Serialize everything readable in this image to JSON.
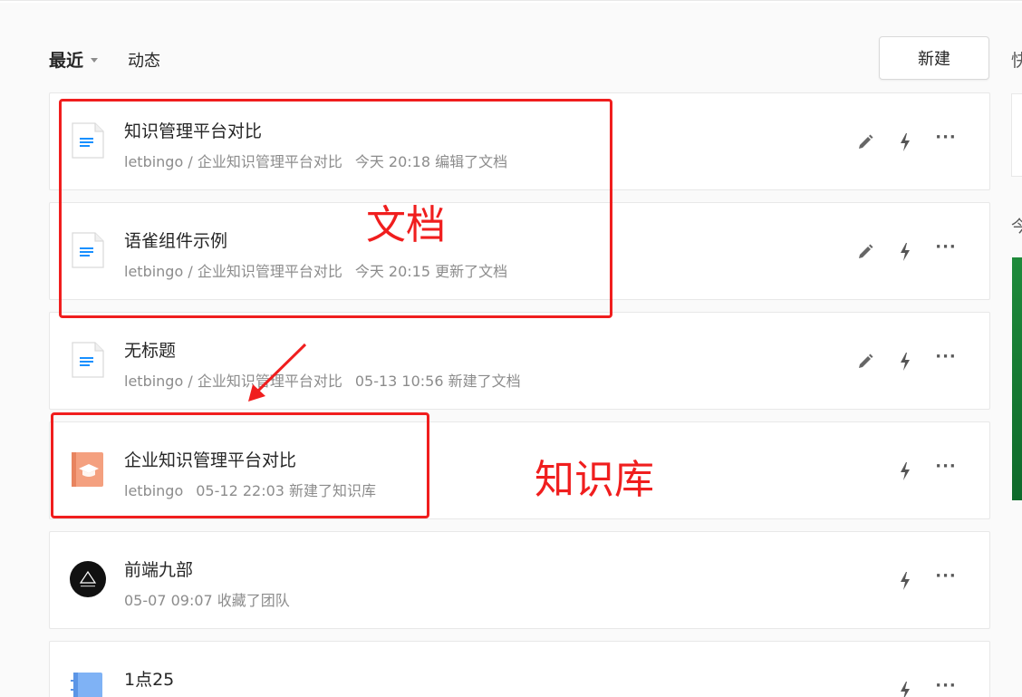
{
  "header": {
    "tab_recent": "最近",
    "tab_activity": "动态",
    "new_button": "新建",
    "right_partial_heading": "快",
    "right_partial_label": "今"
  },
  "items": [
    {
      "type": "doc",
      "title": "知识管理平台对比",
      "path": "letbingo / 企业知识管理平台对比",
      "time": "今天 20:18",
      "action": "编辑了文档",
      "icon": "document-icon",
      "editable": true
    },
    {
      "type": "doc",
      "title": "语雀组件示例",
      "path": "letbingo / 企业知识管理平台对比",
      "time": "今天 20:15",
      "action": "更新了文档",
      "icon": "document-icon",
      "editable": true
    },
    {
      "type": "doc",
      "title": "无标题",
      "path": "letbingo / 企业知识管理平台对比",
      "time": "05-13 10:56",
      "action": "新建了文档",
      "icon": "document-icon",
      "editable": true
    },
    {
      "type": "book",
      "title": "企业知识管理平台对比",
      "path": "letbingo",
      "time": "05-12 22:03",
      "action": "新建了知识库",
      "icon": "knowledge-base-icon",
      "editable": false
    },
    {
      "type": "team",
      "title": "前端九部",
      "path": "",
      "time": "05-07 09:07",
      "action": "收藏了团队",
      "icon": "team-avatar",
      "editable": false
    },
    {
      "type": "notebook",
      "title": "1点25",
      "path": "",
      "time": "",
      "action": "",
      "icon": "notebook-icon",
      "editable": false
    }
  ],
  "annotations": {
    "docs_label": "文档",
    "kb_label": "知识库"
  },
  "colors": {
    "annotation_red": "#f01e1e",
    "doc_blue": "#1890ff",
    "kb_orange": "#f4a07f"
  }
}
